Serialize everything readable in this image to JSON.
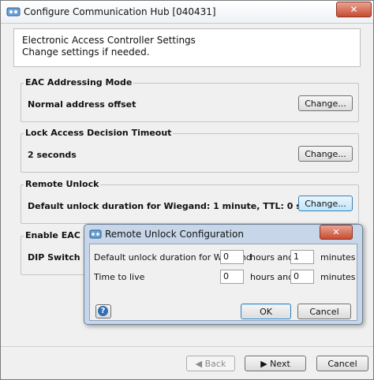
{
  "window": {
    "title": "Configure Communication Hub [040431]",
    "close_label": "✕"
  },
  "header": {
    "title": "Electronic Access Controller Settings",
    "subtitle": "Change settings if needed."
  },
  "groups": [
    {
      "label": "EAC Addressing Mode",
      "value": "Normal address offset",
      "button": "Change..."
    },
    {
      "label": "Lock Access Decision Timeout",
      "value": "2 seconds",
      "button": "Change..."
    },
    {
      "label": "Remote Unlock",
      "value": "Default unlock duration for Wiegand: 1 minute, TTL: 0 seconds",
      "button": "Change..."
    },
    {
      "label": "Enable EAC Add",
      "value": "DIP Switch ena"
    }
  ],
  "footer": {
    "back_label": "Back",
    "next_label": "Next",
    "cancel_label": "Cancel"
  },
  "dialog": {
    "title": "Remote Unlock Configuration",
    "close_label": "✕",
    "rows": [
      {
        "label": "Default unlock duration for Wiegand",
        "hours": "0",
        "hours_label": "hours and",
        "minutes": "1",
        "minutes_label": "minutes"
      },
      {
        "label": "Time to live",
        "hours": "0",
        "hours_label": "hours and",
        "minutes": "0",
        "minutes_label": "minutes"
      }
    ],
    "ok_label": "OK",
    "cancel_label": "Cancel",
    "help_label": "?"
  },
  "colors": {
    "dialog_frame": "#c7d6e8",
    "close_button": "#c84b32",
    "hover_button": "#bee6fd"
  }
}
